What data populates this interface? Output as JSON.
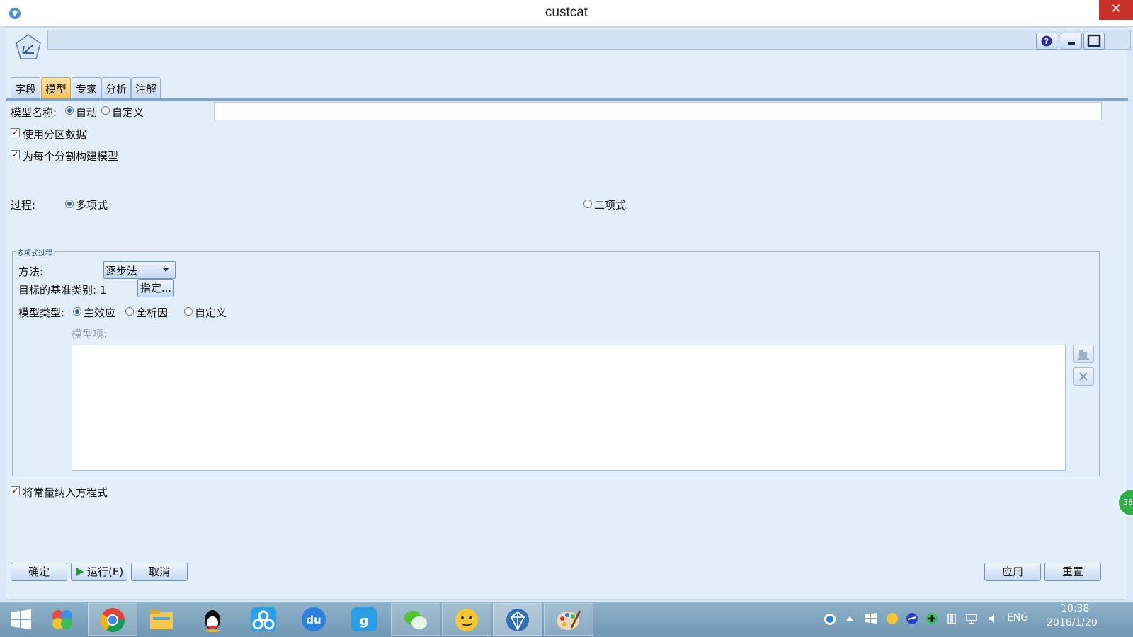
{
  "window": {
    "title": "custcat",
    "close_glyph": "✕"
  },
  "tabs": [
    {
      "label": "字段",
      "active": false
    },
    {
      "label": "模型",
      "active": true
    },
    {
      "label": "专家",
      "active": false
    },
    {
      "label": "分析",
      "active": false
    },
    {
      "label": "注解",
      "active": false
    }
  ],
  "model_name": {
    "label": "模型名称:",
    "option_auto": "自动",
    "option_custom": "自定义",
    "selected": "auto",
    "value": ""
  },
  "use_partition": {
    "label": "使用分区数据",
    "checked": true
  },
  "build_per_split": {
    "label": "为每个分割构建模型",
    "checked": true
  },
  "procedure": {
    "label": "过程:",
    "option_multinomial": "多项式",
    "option_binomial": "二项式",
    "selected": "multinomial"
  },
  "multinomial_group": {
    "title": "多项式过程",
    "method_label": "方法:",
    "method_value": "逐步法",
    "base_category_label": "目标的基准类别: 1",
    "specify_button": "指定...",
    "model_type_label": "模型类型:",
    "type_main": "主效应",
    "type_full": "全析因",
    "type_custom": "自定义",
    "selected_type": "main",
    "model_terms_label": "模型项:"
  },
  "include_constant": {
    "label": "将常量纳入方程式",
    "checked": true
  },
  "buttons": {
    "ok": "确定",
    "run": "运行(E)",
    "cancel": "取消",
    "apply": "应用",
    "reset": "重置"
  },
  "floating_badge": "38",
  "taskbar": {
    "apps": [
      "start-icon",
      "app-icon",
      "chrome-icon",
      "file-explorer-icon",
      "qq-icon",
      "cloud-icon",
      "baidu-du-icon",
      "app-icon",
      "wechat-icon",
      "emoji-app-icon",
      "spss-modeler-icon",
      "paint-icon"
    ],
    "language": "ENG",
    "time": "10:38",
    "date": "2016/1/20"
  },
  "colors": {
    "accent": "#2a62b8",
    "active_tab": "#f5c45a",
    "close": "#c7312a"
  }
}
